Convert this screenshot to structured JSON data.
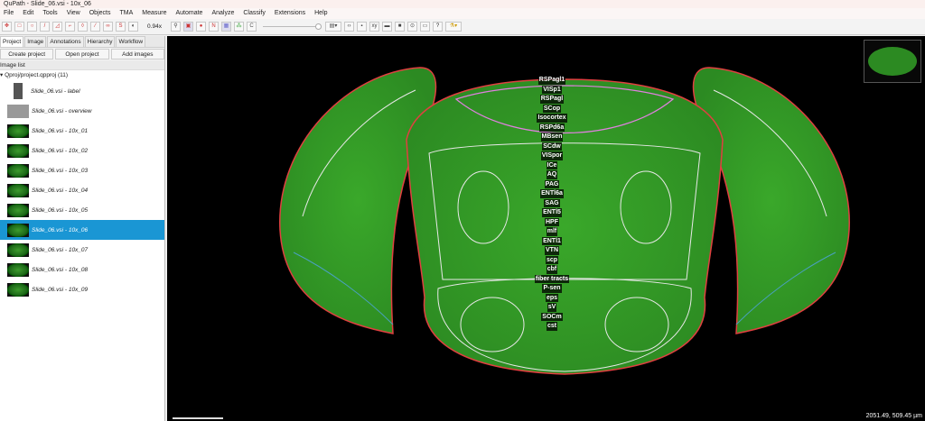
{
  "window": {
    "title": "QuPath - Slide_06.vsi - 10x_06"
  },
  "menu": [
    "File",
    "Edit",
    "Tools",
    "View",
    "Objects",
    "TMA",
    "Measure",
    "Automate",
    "Analyze",
    "Classify",
    "Extensions",
    "Help"
  ],
  "toolbar": {
    "zoom": "0.94x",
    "tools": [
      "move",
      "rectangle",
      "ellipse",
      "line",
      "polygon",
      "polyline",
      "brush",
      "wand",
      "points",
      "selection-mode"
    ],
    "overlay_n": "N",
    "overlay_c": "C"
  },
  "sidebar": {
    "tabs": [
      "Project",
      "Image",
      "Annotations",
      "Hierarchy",
      "Workflow"
    ],
    "buttons": {
      "create": "Create project",
      "open": "Open project",
      "add": "Add images"
    },
    "image_list_header": "Image list",
    "project_root": "Qproj/project.qpproj (11)",
    "images": [
      {
        "name": "Slide_06.vsi - label",
        "thumb": "label"
      },
      {
        "name": "Slide_06.vsi - overview",
        "thumb": "ov"
      },
      {
        "name": "Slide_06.vsi - 10x_01",
        "thumb": "green"
      },
      {
        "name": "Slide_06.vsi - 10x_02",
        "thumb": "green"
      },
      {
        "name": "Slide_06.vsi - 10x_03",
        "thumb": "green"
      },
      {
        "name": "Slide_06.vsi - 10x_04",
        "thumb": "green"
      },
      {
        "name": "Slide_06.vsi - 10x_05",
        "thumb": "green"
      },
      {
        "name": "Slide_06.vsi - 10x_06",
        "thumb": "green",
        "selected": true
      },
      {
        "name": "Slide_06.vsi - 10x_07",
        "thumb": "green"
      },
      {
        "name": "Slide_06.vsi - 10x_08",
        "thumb": "green"
      },
      {
        "name": "Slide_06.vsi - 10x_09",
        "thumb": "green"
      }
    ]
  },
  "viewer": {
    "region_labels": [
      "RSPagl1",
      "VISp1",
      "RSPagl",
      "SCop",
      "Isocortex",
      "RSPd6a",
      "MBsen",
      "SCdw",
      "VISpor",
      "ICe",
      "AQ",
      "PAG",
      "ENTl6a",
      "SAG",
      "ENTl5",
      "HPF",
      "mlf",
      "ENTl1",
      "VTN",
      "scp",
      "cbf",
      "fiber tracts",
      "P-sen",
      "eps",
      "sV",
      "SOCm",
      "cst"
    ],
    "cursor_readout": "2051.49, 509.45 µm",
    "colors": {
      "tissue": "#3aa82a",
      "outline_red": "#e04040",
      "outline_white": "#e8e8e8",
      "outline_pink": "#e080e0",
      "selected": "#1a96d4"
    }
  }
}
